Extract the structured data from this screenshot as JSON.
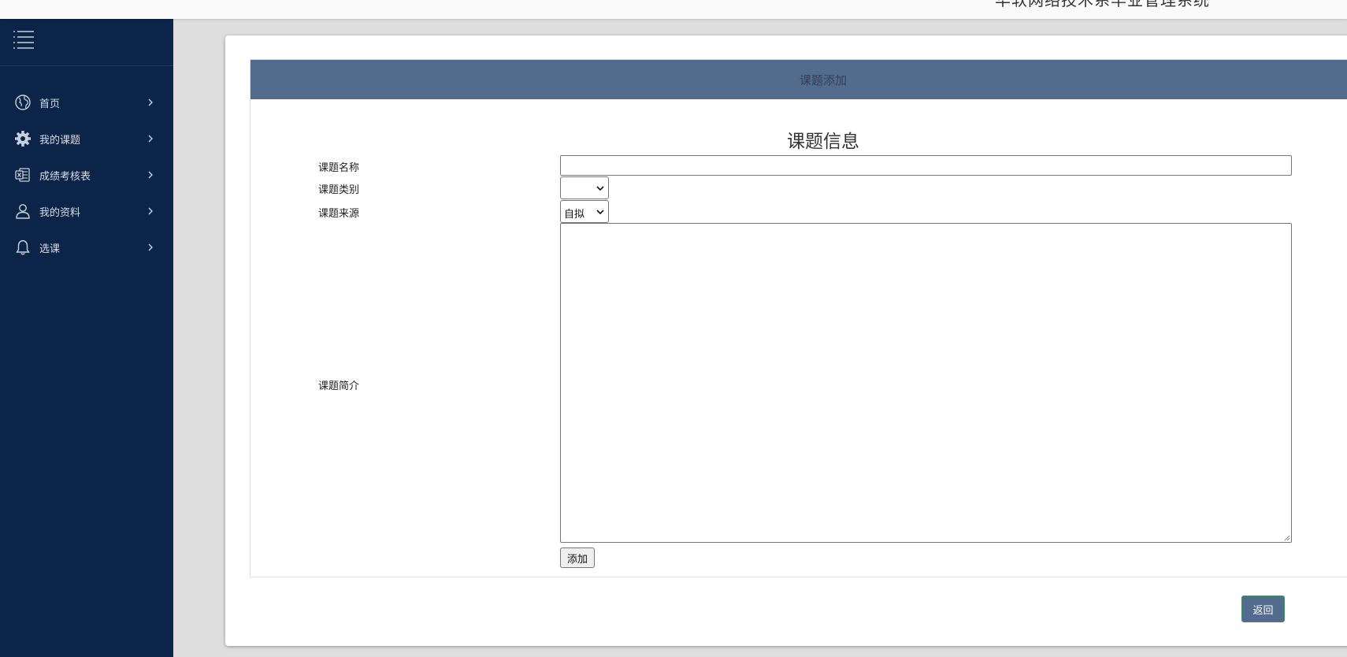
{
  "app": {
    "title": "华软网络技术系毕业管理系统"
  },
  "sidebar": {
    "items": [
      {
        "label": "首页",
        "icon": "globe-icon"
      },
      {
        "label": "我的课题",
        "icon": "gear-icon"
      },
      {
        "label": "成绩考核表",
        "icon": "excel-file-icon"
      },
      {
        "label": "我的资料",
        "icon": "user-icon"
      },
      {
        "label": "选课",
        "icon": "bell-icon"
      }
    ]
  },
  "panel": {
    "heading": "课题添加"
  },
  "form": {
    "title": "课题信息",
    "name_label": "课题名称",
    "name_value": "",
    "category_label": "课题类别",
    "category_value": "",
    "source_label": "课题来源",
    "source_value": "自拟",
    "intro_label": "课题简介",
    "intro_value": "",
    "add_button": "添加"
  },
  "footer": {
    "back_button": "返回"
  },
  "colors": {
    "sidebar_bg": "#0b2448",
    "panel_header_bg": "#536b8d",
    "page_bg": "#dedede"
  }
}
